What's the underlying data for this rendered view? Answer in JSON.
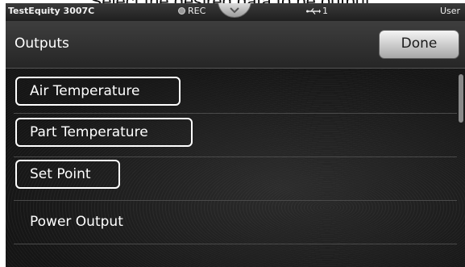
{
  "caption": "Select the desired data to be output.",
  "status_bar": {
    "device": "TestEquity 3007C",
    "rec_label": "REC",
    "usb_count": "1",
    "user_label": "User",
    "pull_tab_icon": "chevron-down-icon",
    "usb_icon": "usb-icon"
  },
  "header": {
    "title": "Outputs",
    "done_label": "Done"
  },
  "outputs": [
    {
      "label": "Air Temperature",
      "selected": true
    },
    {
      "label": "Part Temperature",
      "selected": true
    },
    {
      "label": "Set Point",
      "selected": true
    },
    {
      "label": "Power Output",
      "selected": false
    }
  ],
  "colors": {
    "screen_bg": "#161616",
    "selection_outline": "#ffffff",
    "button_face": "#d9d9d9"
  }
}
